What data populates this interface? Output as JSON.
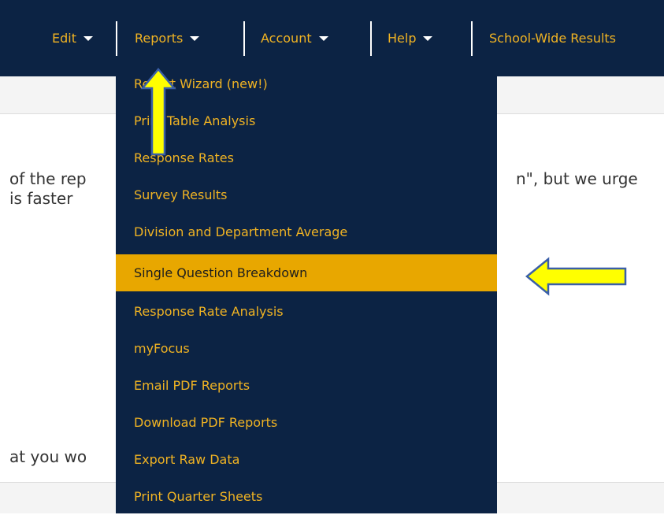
{
  "navbar": {
    "items": [
      {
        "label": "Edit"
      },
      {
        "label": "Reports"
      },
      {
        "label": "Account"
      },
      {
        "label": "Help"
      },
      {
        "label": "School-Wide Results"
      }
    ]
  },
  "background_text": {
    "line1_left": "of the rep",
    "line1_right": "n\", but we urge",
    "line2": "is faster",
    "line3": "at you wo"
  },
  "reports_menu": {
    "items": [
      {
        "label": "Report Wizard (new!)"
      },
      {
        "label": "Print Table Analysis"
      },
      {
        "label": "Response Rates"
      },
      {
        "label": "Survey Results"
      },
      {
        "label": "Division and Department Average"
      },
      {
        "label": "Single Question Breakdown",
        "state": "highlighted"
      },
      {
        "label": "Response Rate Analysis"
      },
      {
        "label": "myFocus"
      },
      {
        "label": "Email PDF Reports"
      },
      {
        "label": "Download PDF Reports"
      },
      {
        "label": "Export Raw Data"
      },
      {
        "label": "Print Quarter Sheets"
      }
    ]
  },
  "colors": {
    "navbar_bg": "#0c2344",
    "menu_text": "#f0b323",
    "highlight_bg": "#e8a700",
    "annotation_arrow": "#ffff00"
  },
  "annotations": {
    "up_arrow_icon": "yellow-up-arrow",
    "left_arrow_icon": "yellow-left-arrow"
  }
}
